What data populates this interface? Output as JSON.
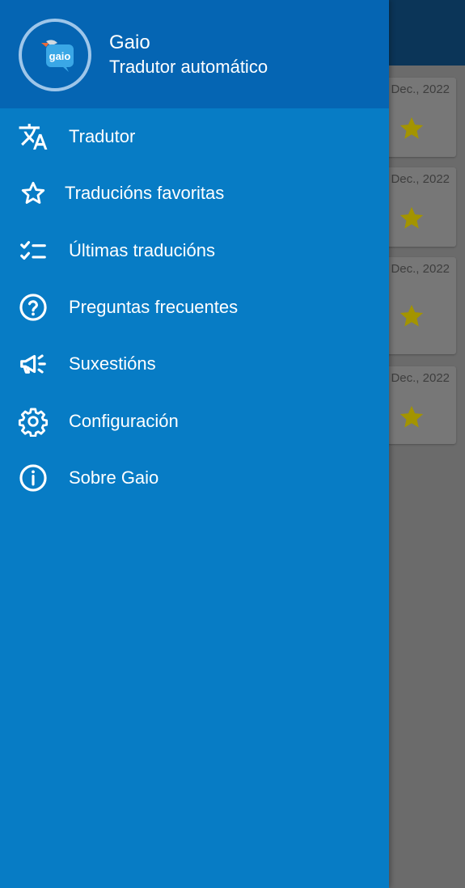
{
  "header": {
    "app_name": "Gaio",
    "subtitle": "Tradutor automático",
    "logo_text": "gaio"
  },
  "menu": {
    "items": [
      {
        "label": "Tradutor",
        "icon": "translate-icon"
      },
      {
        "label": "Traducións favoritas",
        "icon": "star-outline-icon"
      },
      {
        "label": "Últimas traducións",
        "icon": "checklist-icon"
      },
      {
        "label": "Preguntas frecuentes",
        "icon": "help-circle-icon"
      },
      {
        "label": "Suxestións",
        "icon": "megaphone-icon"
      },
      {
        "label": "Configuración",
        "icon": "gear-icon"
      },
      {
        "label": "Sobre Gaio",
        "icon": "info-icon"
      }
    ]
  },
  "background": {
    "cards": [
      {
        "date": "Dec., 2022"
      },
      {
        "date": "Dec., 2022"
      },
      {
        "date": "Dec., 2022"
      },
      {
        "date": "Dec., 2022"
      }
    ]
  },
  "colors": {
    "drawer": "#077cc5",
    "header": "#0565b3",
    "star": "#a39400"
  }
}
